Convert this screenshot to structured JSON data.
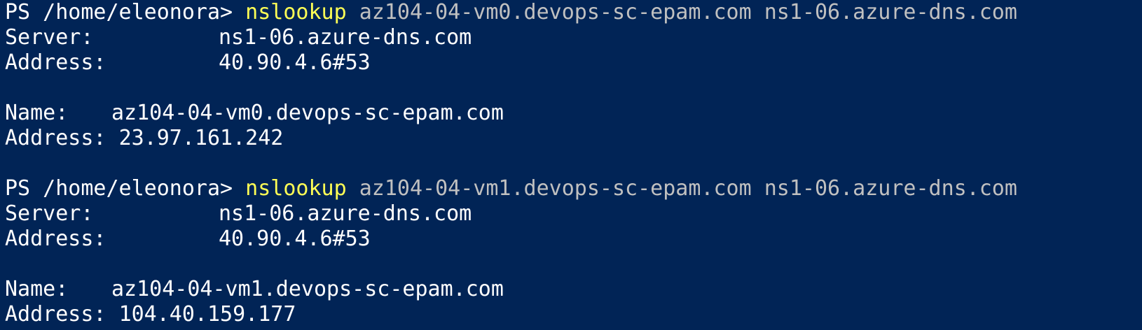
{
  "colors": {
    "background": "#012456",
    "text": "#ffffff",
    "command": "#ffff55",
    "arguments": "#c0c0c0"
  },
  "blocks": [
    {
      "prompt": "PS /home/eleonora> ",
      "command": "nslookup",
      "arguments": " az104-04-vm0.devops-sc-epam.com ns1-06.azure-dns.com",
      "server_label": "Server:",
      "server_value": "ns1-06.azure-dns.com",
      "server_address_label": "Address:",
      "server_address_value": "40.90.4.6#53",
      "name_label": "Name:",
      "name_value": "az104-04-vm0.devops-sc-epam.com",
      "address_label": "Address:",
      "address_value": "23.97.161.242"
    },
    {
      "prompt": "PS /home/eleonora> ",
      "command": "nslookup",
      "arguments": " az104-04-vm1.devops-sc-epam.com ns1-06.azure-dns.com",
      "server_label": "Server:",
      "server_value": "ns1-06.azure-dns.com",
      "server_address_label": "Address:",
      "server_address_value": "40.90.4.6#53",
      "name_label": "Name:",
      "name_value": "az104-04-vm1.devops-sc-epam.com",
      "address_label": "Address:",
      "address_value": "104.40.159.177"
    }
  ]
}
